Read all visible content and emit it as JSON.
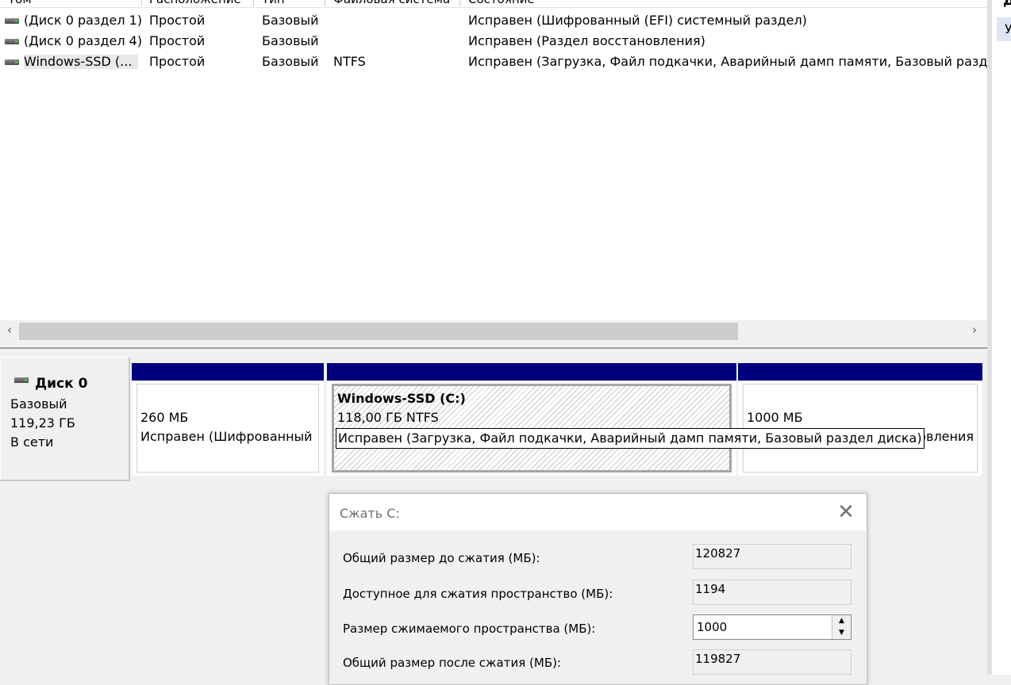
{
  "columns": [
    "Том",
    "Расположение",
    "Тип",
    "Файловая система",
    "Состояние"
  ],
  "volumes": [
    {
      "name": "(Диск 0 раздел 1)",
      "layout": "Простой",
      "type": "Базовый",
      "fs": "",
      "status": "Исправен (Шифрованный (EFI) системный раздел)"
    },
    {
      "name": "(Диск 0 раздел 4)",
      "layout": "Простой",
      "type": "Базовый",
      "fs": "",
      "status": "Исправен (Раздел восстановления)"
    },
    {
      "name": "Windows-SSD (...",
      "layout": "Простой",
      "type": "Базовый",
      "fs": "NTFS",
      "status": "Исправен (Загрузка, Файл подкачки, Аварийный дамп памяти, Базовый разде"
    }
  ],
  "scroll": {
    "left": "‹",
    "right": "›"
  },
  "right_pane": {
    "title": "Д",
    "item": "У"
  },
  "disk": {
    "name": "Диск 0",
    "kind": "Базовый",
    "size": "119,23 ГБ",
    "state": "В сети"
  },
  "partitions": [
    {
      "size": "260 МБ",
      "status": "Исправен (Шифрованный"
    },
    {
      "title": "Windows-SSD  (C:)",
      "size": "118,00 ГБ NTFS"
    },
    {
      "size": "1000 МБ",
      "status": "новления"
    }
  ],
  "tooltip": "Исправен (Загрузка, Файл подкачки, Аварийный дамп памяти, Базовый раздел диска)",
  "dialog": {
    "title": "Сжать С:",
    "close": "✕",
    "rows": [
      {
        "label": "Общий размер до сжатия (МБ):",
        "value": "120827"
      },
      {
        "label": "Доступное для сжатия пространство (МБ):",
        "value": "1194"
      },
      {
        "label": "Размер сжимаемого пространства (МБ):",
        "value": "1000"
      },
      {
        "label": "Общий размер после сжатия (МБ):",
        "value": "119827"
      }
    ],
    "spin_up": "▲",
    "spin_down": "▼"
  }
}
